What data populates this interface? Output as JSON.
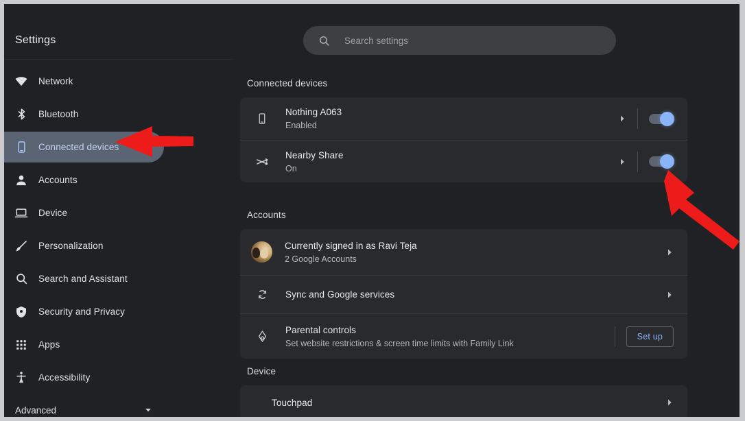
{
  "app": {
    "title": "Settings"
  },
  "search": {
    "placeholder": "Search settings",
    "value": "",
    "icon": "search-icon"
  },
  "sidebar": {
    "items": [
      {
        "label": "Network",
        "icon": "wifi-icon",
        "selected": false
      },
      {
        "label": "Bluetooth",
        "icon": "bluetooth-icon",
        "selected": false
      },
      {
        "label": "Connected devices",
        "icon": "phone-icon",
        "selected": true
      },
      {
        "label": "Accounts",
        "icon": "person-icon",
        "selected": false
      },
      {
        "label": "Device",
        "icon": "laptop-icon",
        "selected": false
      },
      {
        "label": "Personalization",
        "icon": "brush-icon",
        "selected": false
      },
      {
        "label": "Search and Assistant",
        "icon": "search-icon",
        "selected": false
      },
      {
        "label": "Security and Privacy",
        "icon": "shield-icon",
        "selected": false
      },
      {
        "label": "Apps",
        "icon": "grid-icon",
        "selected": false
      },
      {
        "label": "Accessibility",
        "icon": "accessibility-icon",
        "selected": false
      }
    ],
    "advanced": {
      "label": "Advanced",
      "icon": "chevron-down-icon"
    }
  },
  "main": {
    "connected_devices": {
      "title": "Connected devices",
      "rows": [
        {
          "title": "Nothing A063",
          "subtitle": "Enabled",
          "icon": "phone-icon",
          "has_chevron": true,
          "toggle": "on"
        },
        {
          "title": "Nearby Share",
          "subtitle": "On",
          "icon": "nearby-share-icon",
          "has_chevron": true,
          "toggle": "on"
        }
      ]
    },
    "accounts": {
      "title": "Accounts",
      "rows": [
        {
          "title": "Currently signed in as Ravi Teja",
          "subtitle": "2 Google Accounts",
          "icon": "avatar",
          "has_chevron": true
        },
        {
          "title": "Sync and Google services",
          "subtitle": "",
          "icon": "sync-icon",
          "has_chevron": true
        },
        {
          "title": "Parental controls",
          "subtitle": "Set website restrictions & screen time limits with Family Link",
          "icon": "family-link-icon",
          "button": "Set up"
        }
      ]
    },
    "device": {
      "title": "Device",
      "rows": [
        {
          "title": "Touchpad",
          "subtitle": "",
          "icon": "",
          "has_chevron": true
        }
      ]
    }
  },
  "annotations": {
    "arrow_color": "#ee1b1b",
    "arrows": [
      {
        "name": "arrow-to-connected-devices",
        "direction": "left"
      },
      {
        "name": "arrow-to-nearby-share-toggle",
        "direction": "up-left"
      }
    ]
  },
  "colors": {
    "page_background": "#202124",
    "card_background": "#292a2d",
    "accent_blue": "#8ab4f8",
    "selected_nav": "#5b6472",
    "frame": "#c9cbce"
  }
}
